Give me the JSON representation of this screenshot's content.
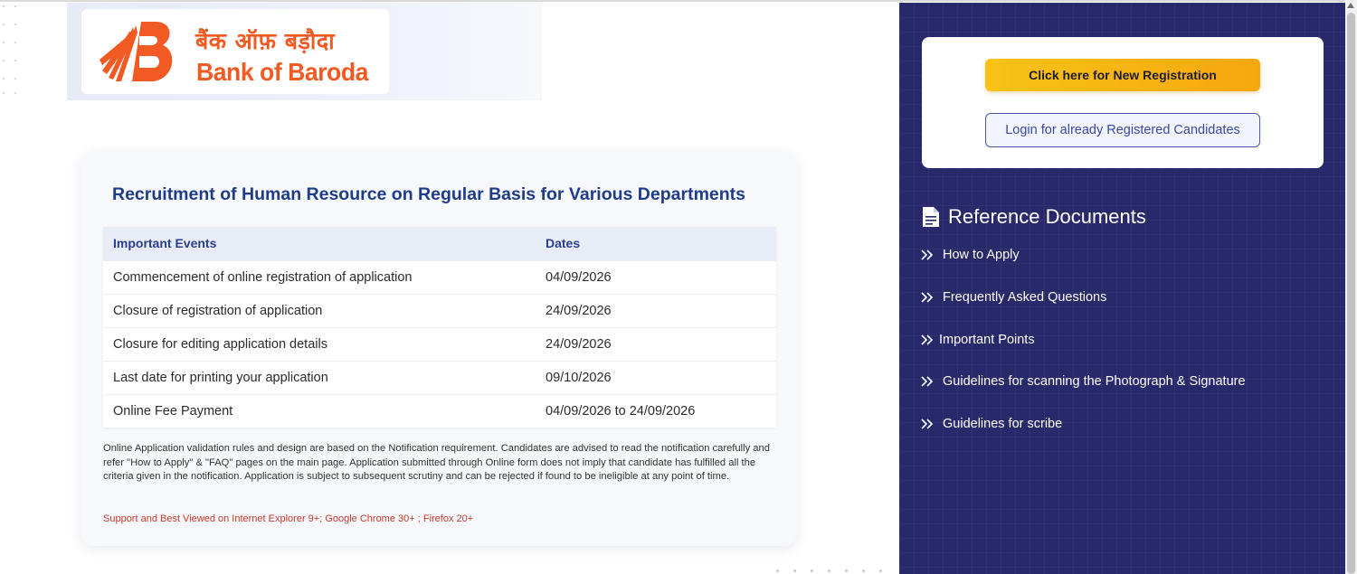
{
  "logo": {
    "hindi": "बैंक ऑफ़ बड़ौदा",
    "english": "Bank of Baroda",
    "brand_color": "#f15a22"
  },
  "main": {
    "title": "Recruitment of Human Resource on Regular Basis for Various Departments",
    "table": {
      "headers": [
        "Important Events",
        "Dates"
      ],
      "rows": [
        [
          "Commencement of online registration of application",
          "04/09/2026"
        ],
        [
          "Closure of registration of application",
          "24/09/2026"
        ],
        [
          "Closure for editing application details",
          "24/09/2026"
        ],
        [
          "Last date for printing your application",
          "09/10/2026"
        ],
        [
          "Online Fee Payment",
          "04/09/2026 to 24/09/2026"
        ]
      ]
    },
    "note": "Online Application validation rules and design are based on the Notification requirement. Candidates are advised to read the notification carefully and refer \"How to Apply\" & \"FAQ\" pages on the main page. Application submitted through Online form does not imply that candidate has fulfilled all the criteria given in the notification. Application is subject to subsequent scrutiny and can be rejected if found to be ineligible at any point of time.",
    "support": "Support and Best Viewed on Internet Explorer 9+; Google Chrome 30+ ; Firefox 20+"
  },
  "sidebar": {
    "new_registration_label": "Click here for New Registration",
    "login_label": "Login for already Registered Candidates",
    "reference_heading": "Reference Documents",
    "reference_icon": "document-icon",
    "reference_items": [
      {
        "label": "How to Apply"
      },
      {
        "label": "Frequently Asked Questions"
      },
      {
        "label": "Important Points"
      },
      {
        "label": "Guidelines for scanning the Photograph & Signature"
      },
      {
        "label": "Guidelines for scribe"
      }
    ],
    "panel_color": "#27296b",
    "accent_color": "#f8c316"
  }
}
